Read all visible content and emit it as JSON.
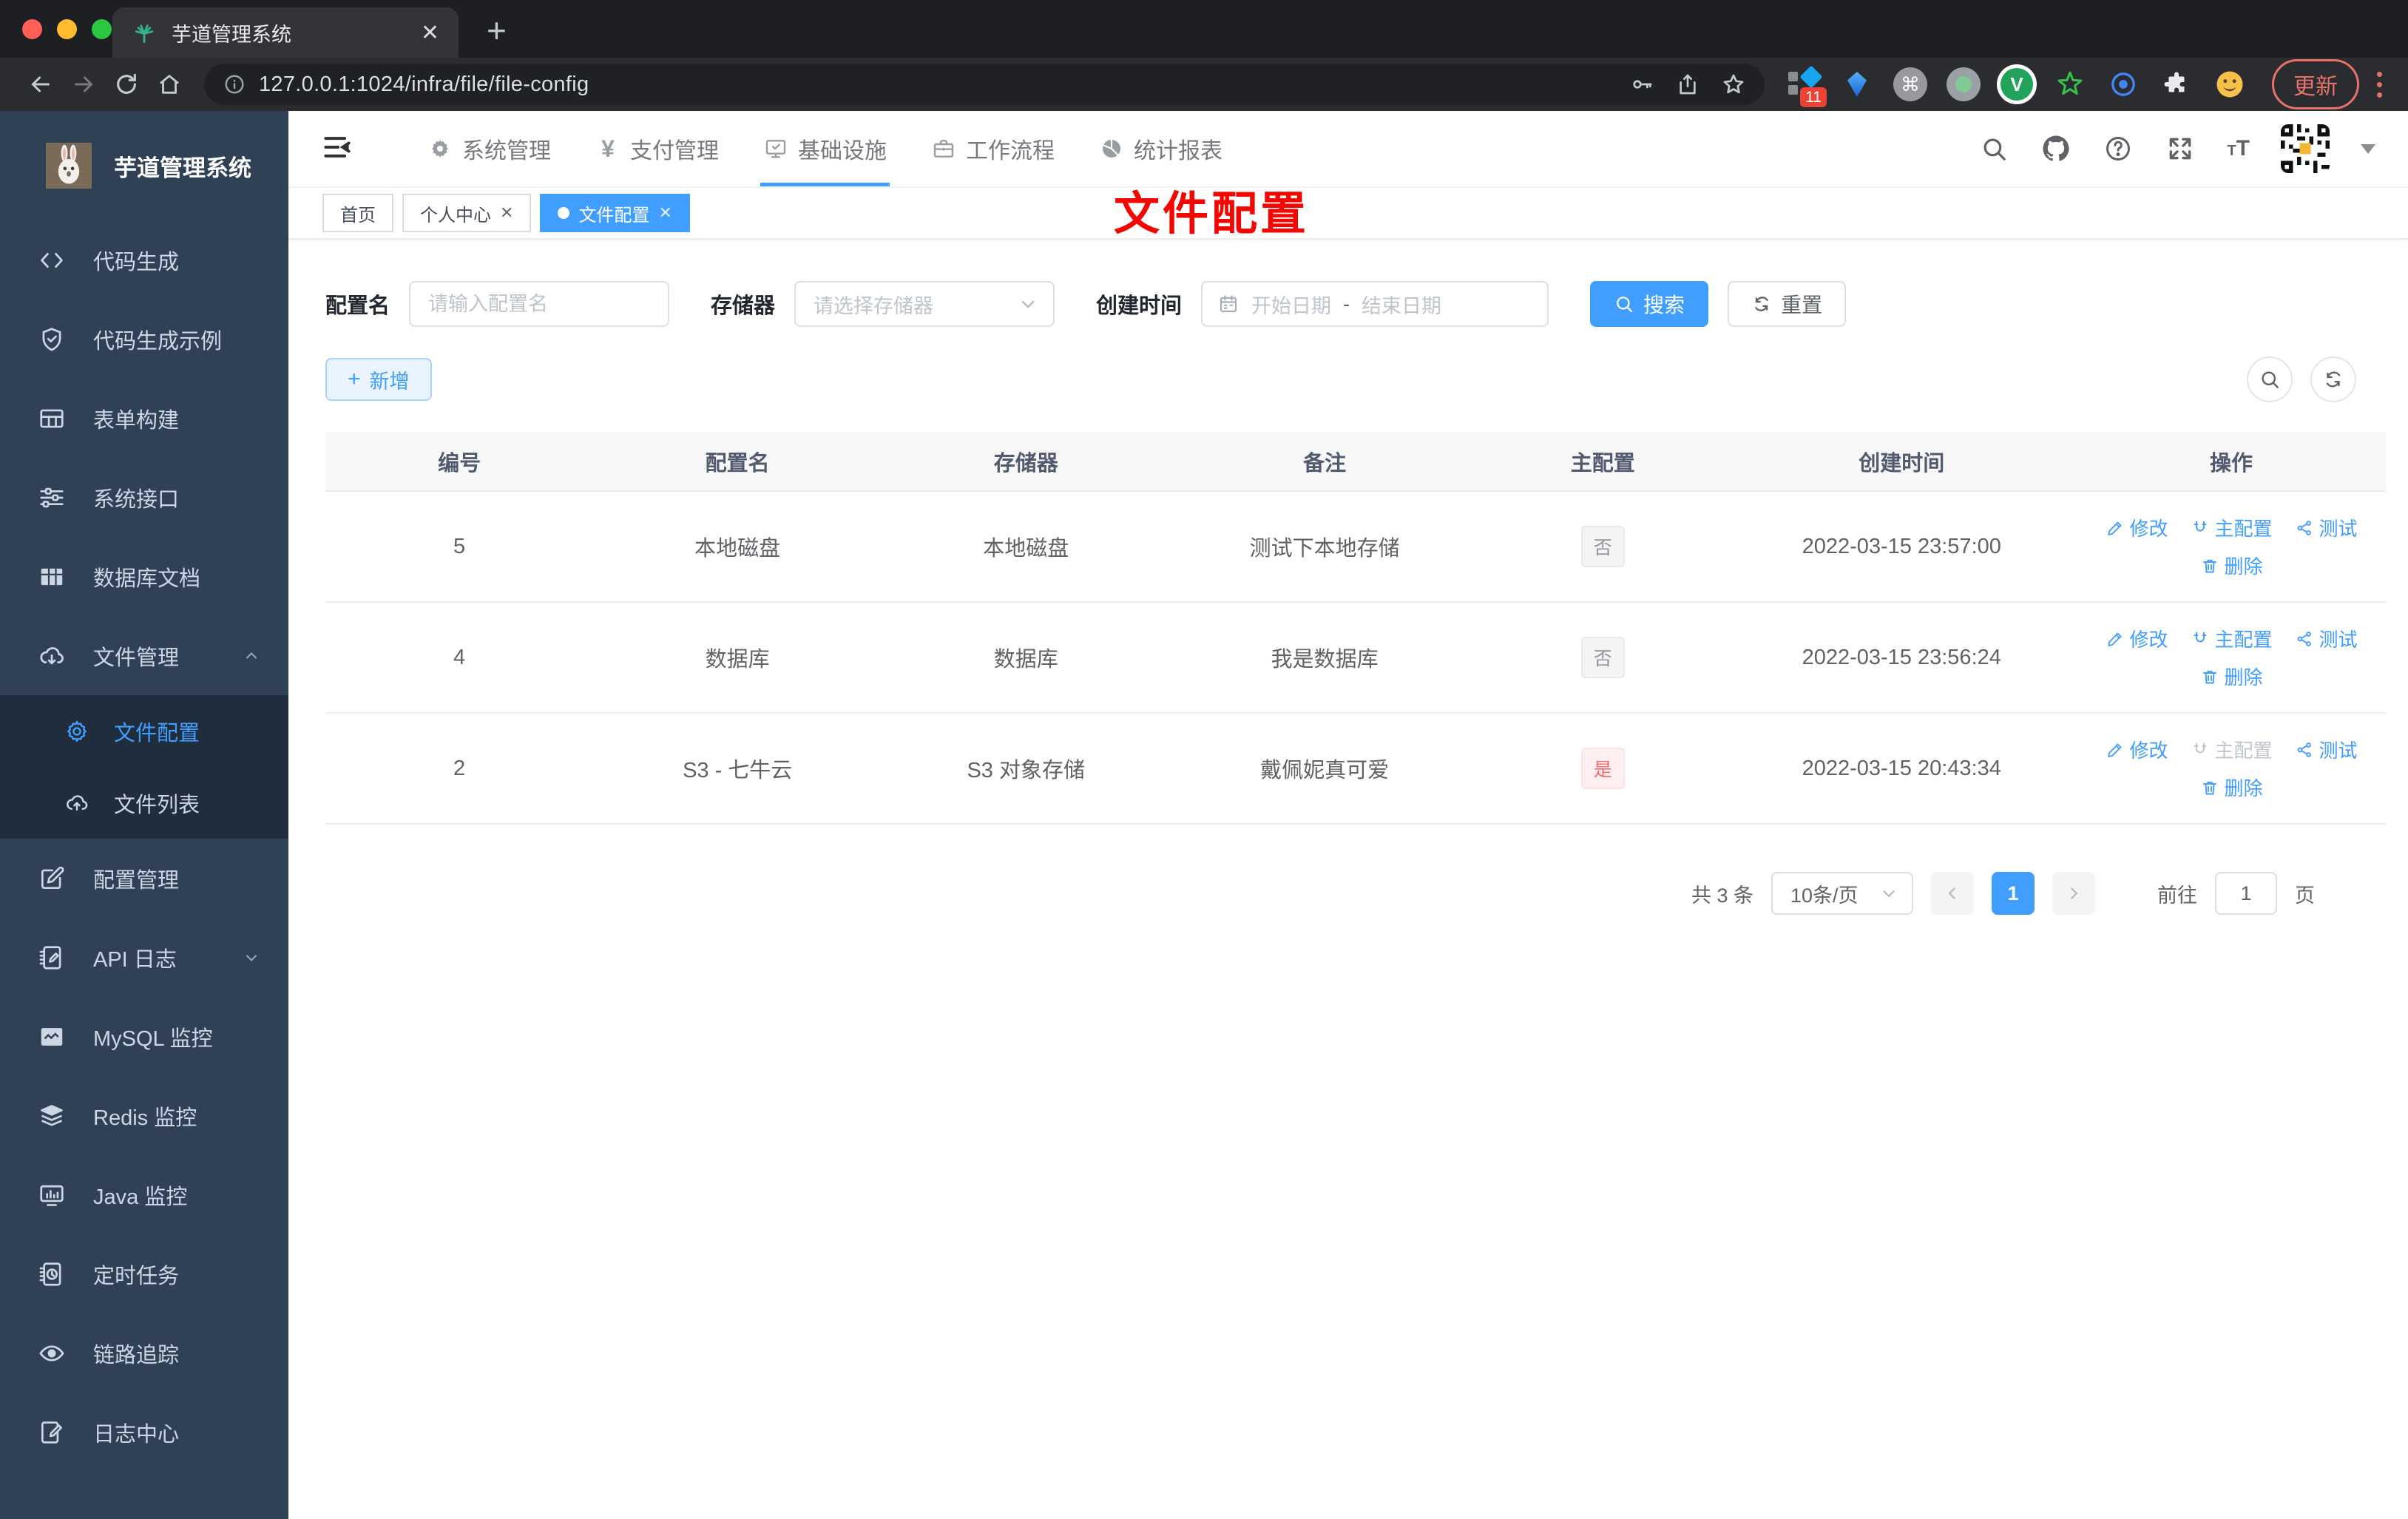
{
  "browser": {
    "tab_title": "芋道管理系统",
    "url": "127.0.0.1:1024/infra/file/file-config",
    "update_button": "更新",
    "extension_badge": "11",
    "toolbar_icons": [
      "back",
      "forward",
      "reload",
      "home",
      "info",
      "key",
      "share",
      "star",
      "puzzle"
    ]
  },
  "annotation": "文件配置",
  "colors": {
    "accent": "#409eff",
    "danger": "#f56c6c",
    "sidebar_bg": "#304156",
    "submenu_bg": "#1f2d3d",
    "annotation_red": "#f50500",
    "update_red": "#e8716a",
    "favicon_green": "#35b28a"
  },
  "sidebar": {
    "title": "芋道管理系统",
    "items": [
      {
        "label": "代码生成",
        "icon": "code"
      },
      {
        "label": "代码生成示例",
        "icon": "shield-check"
      },
      {
        "label": "表单构建",
        "icon": "form-grid"
      },
      {
        "label": "系统接口",
        "icon": "sliders"
      },
      {
        "label": "数据库文档",
        "icon": "table-filled"
      },
      {
        "label": "文件管理",
        "icon": "cloud-download",
        "expanded": true
      },
      {
        "label": "文件配置",
        "icon": "gear",
        "active": true,
        "sub": true
      },
      {
        "label": "文件列表",
        "icon": "cloud-upload",
        "sub": true
      },
      {
        "label": "配置管理",
        "icon": "edit-square"
      },
      {
        "label": "API 日志",
        "icon": "log-doc",
        "collapsed": true
      },
      {
        "label": "MySQL 监控",
        "icon": "chart-monitor"
      },
      {
        "label": "Redis 监控",
        "icon": "layers"
      },
      {
        "label": "Java 监控",
        "icon": "monitor"
      },
      {
        "label": "定时任务",
        "icon": "schedule"
      },
      {
        "label": "链路追踪",
        "icon": "eye"
      },
      {
        "label": "日志中心",
        "icon": "log-pencil"
      }
    ]
  },
  "topnav": {
    "items": [
      {
        "label": "系统管理",
        "icon": "gear"
      },
      {
        "label": "支付管理",
        "icon": "yen"
      },
      {
        "label": "基础设施",
        "icon": "monitor-check",
        "active": true
      },
      {
        "label": "工作流程",
        "icon": "briefcase"
      },
      {
        "label": "统计报表",
        "icon": "pie-chart"
      }
    ],
    "right_icons": [
      "search",
      "github",
      "help",
      "fullscreen",
      "font-size",
      "avatar",
      "caret-down"
    ]
  },
  "tags": [
    {
      "label": "首页",
      "closable": false,
      "active": false
    },
    {
      "label": "个人中心",
      "closable": true,
      "active": false
    },
    {
      "label": "文件配置",
      "closable": true,
      "active": true
    }
  ],
  "filters": {
    "name_label": "配置名",
    "name_placeholder": "请输入配置名",
    "storage_label": "存储器",
    "storage_placeholder": "请选择存储器",
    "date_label": "创建时间",
    "date_start_placeholder": "开始日期",
    "date_separator": "-",
    "date_end_placeholder": "结束日期",
    "search_button": "搜索",
    "reset_button": "重置"
  },
  "toolbar": {
    "add_button": "新增"
  },
  "table": {
    "headers": [
      "编号",
      "配置名",
      "存储器",
      "备注",
      "主配置",
      "创建时间",
      "操作"
    ],
    "actions": {
      "edit": "修改",
      "master": "主配置",
      "test": "测试",
      "delete": "删除"
    },
    "rows": [
      {
        "id": "5",
        "name": "本地磁盘",
        "storage": "本地磁盘",
        "remark": "测试下本地存储",
        "master": "否",
        "created": "2022-03-15 23:57:00",
        "master_disabled": false
      },
      {
        "id": "4",
        "name": "数据库",
        "storage": "数据库",
        "remark": "我是数据库",
        "master": "否",
        "created": "2022-03-15 23:56:24",
        "master_disabled": false
      },
      {
        "id": "2",
        "name": "S3 - 七牛云",
        "storage": "S3 对象存储",
        "remark": "戴佩妮真可爱",
        "master": "是",
        "created": "2022-03-15 20:43:34",
        "master_disabled": true
      }
    ]
  },
  "pagination": {
    "total": "共 3 条",
    "page_size": "10条/页",
    "current_page": "1",
    "goto_label": "前往",
    "goto_value": "1",
    "page_label": "页"
  }
}
